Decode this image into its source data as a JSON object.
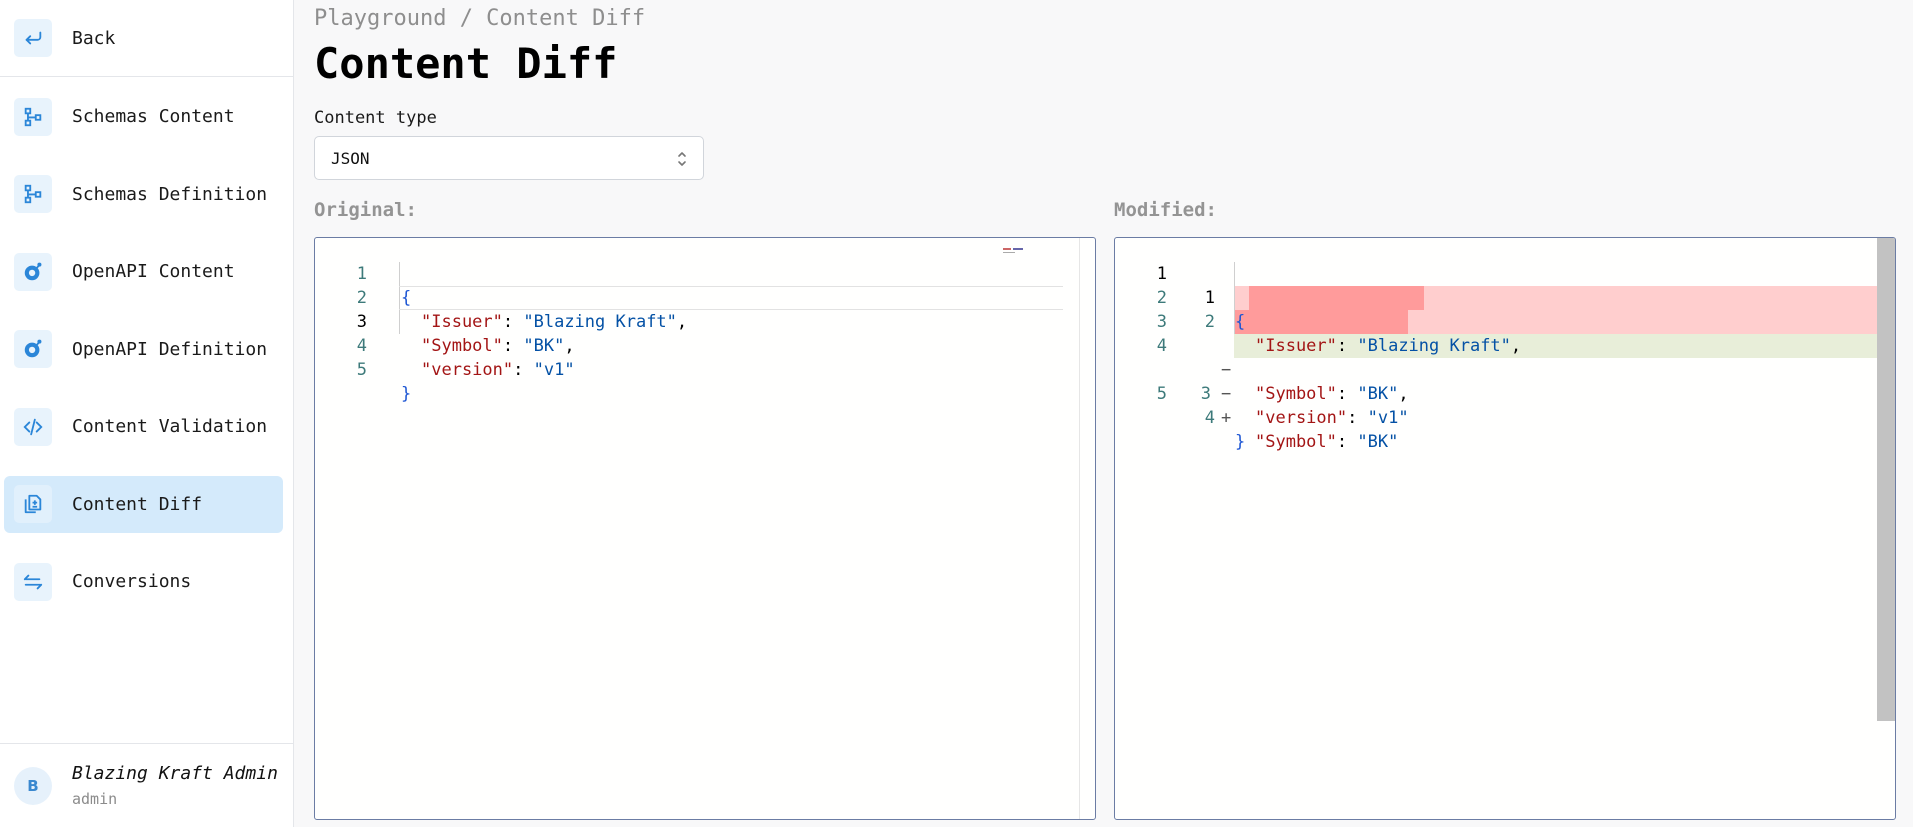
{
  "sidebar": {
    "back_label": "Back",
    "items": [
      {
        "label": "Schemas Content",
        "icon": "schema-icon",
        "active": false
      },
      {
        "label": "Schemas Definition",
        "icon": "schema-icon",
        "active": false
      },
      {
        "label": "OpenAPI Content",
        "icon": "openapi-icon",
        "active": false
      },
      {
        "label": "OpenAPI Definition",
        "icon": "openapi-icon",
        "active": false
      },
      {
        "label": "Content Validation",
        "icon": "code-icon",
        "active": false
      },
      {
        "label": "Content Diff",
        "icon": "diff-icon",
        "active": true
      },
      {
        "label": "Conversions",
        "icon": "arrows-icon",
        "active": false
      }
    ],
    "user": {
      "initial": "B",
      "name": "Blazing Kraft Admin",
      "role": "admin"
    }
  },
  "header": {
    "breadcrumb": "Playground / Content Diff",
    "title": "Content Diff"
  },
  "content_type": {
    "label": "Content type",
    "value": "JSON"
  },
  "original": {
    "label": "Original:",
    "lines": [
      {
        "n": "1",
        "text": "{"
      },
      {
        "n": "2",
        "text": "\"Issuer\": \"Blazing Kraft\","
      },
      {
        "n": "3",
        "text": "\"Symbol\": \"BK\","
      },
      {
        "n": "4",
        "text": "\"version\": \"v1\""
      },
      {
        "n": "5",
        "text": "}"
      }
    ]
  },
  "modified": {
    "label": "Modified:",
    "lines": [
      {
        "a": "1",
        "b": "1",
        "marker": "",
        "text": "{",
        "kind": "same"
      },
      {
        "a": "2",
        "b": "2",
        "marker": "",
        "text": "\"Issuer\": \"Blazing Kraft\",",
        "kind": "same"
      },
      {
        "a": "3",
        "b": "",
        "marker": "−",
        "text": "\"Symbol\": \"BK\",",
        "kind": "removed"
      },
      {
        "a": "4",
        "b": "",
        "marker": "−",
        "text": "\"version\": \"v1\"",
        "kind": "removed"
      },
      {
        "a": "",
        "b": "3",
        "marker": "+",
        "text": "\"Symbol\": \"BK\"",
        "kind": "added"
      },
      {
        "a": "5",
        "b": "4",
        "marker": "",
        "text": "}",
        "kind": "same"
      }
    ]
  },
  "colors": {
    "accent": "#2b86d8",
    "active_bg": "#d4eafb",
    "removed": "#ffcece",
    "removed_strong": "#ff9b9b",
    "added": "#e8eed9",
    "json_key": "#a31515",
    "json_string": "#0451a5"
  }
}
